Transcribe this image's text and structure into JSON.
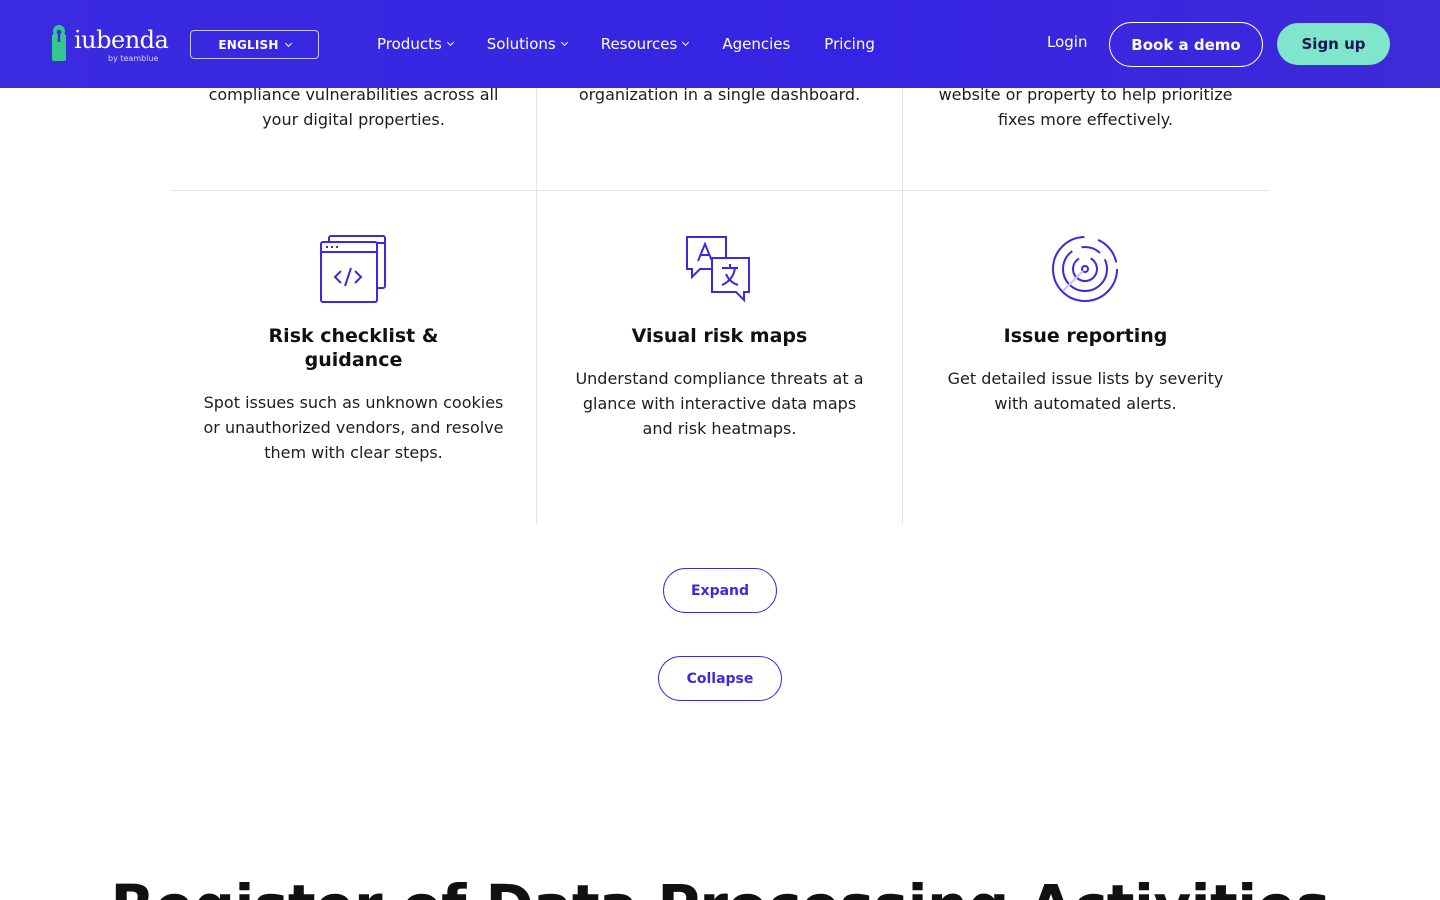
{
  "header": {
    "logo": {
      "name": "iubenda",
      "sub": "by teamblue"
    },
    "language_label": "ENGLISH",
    "nav": [
      {
        "label": "Products",
        "has_dropdown": true
      },
      {
        "label": "Solutions",
        "has_dropdown": true
      },
      {
        "label": "Resources",
        "has_dropdown": true
      },
      {
        "label": "Agencies",
        "has_dropdown": false
      },
      {
        "label": "Pricing",
        "has_dropdown": false
      }
    ],
    "login_label": "Login",
    "demo_label": "Book a demo",
    "signup_label": "Sign up"
  },
  "features_top": [
    {
      "text_line1": "compliance vulnerabilities across all",
      "text_line2": "your digital properties."
    },
    {
      "text_line1": "organization in a single dashboard.",
      "text_line2": ""
    },
    {
      "text_line1": "website or property to help prioritize",
      "text_line2": "fixes more effectively."
    }
  ],
  "features": [
    {
      "icon": "code-window-icon",
      "title": "Risk checklist & guidance",
      "description": "Spot issues such as unknown cookies or unauthorized vendors, and resolve them with clear steps."
    },
    {
      "icon": "translate-chat-icon",
      "title": "Visual risk maps",
      "description": "Understand compliance threats at a glance with interactive data maps and risk heatmaps."
    },
    {
      "icon": "radar-icon",
      "title": "Issue reporting",
      "description": "Get detailed issue lists by severity with automated alerts."
    }
  ],
  "buttons": {
    "expand_label": "Expand",
    "collapse_label": "Collapse"
  },
  "section_title": "Register of Data Processing Activities",
  "colors": {
    "header_bg": "#3a2ae0",
    "accent": "#3a2ae0",
    "signup_bg": "#7fe6cc",
    "logo_green": "#34c78f"
  }
}
